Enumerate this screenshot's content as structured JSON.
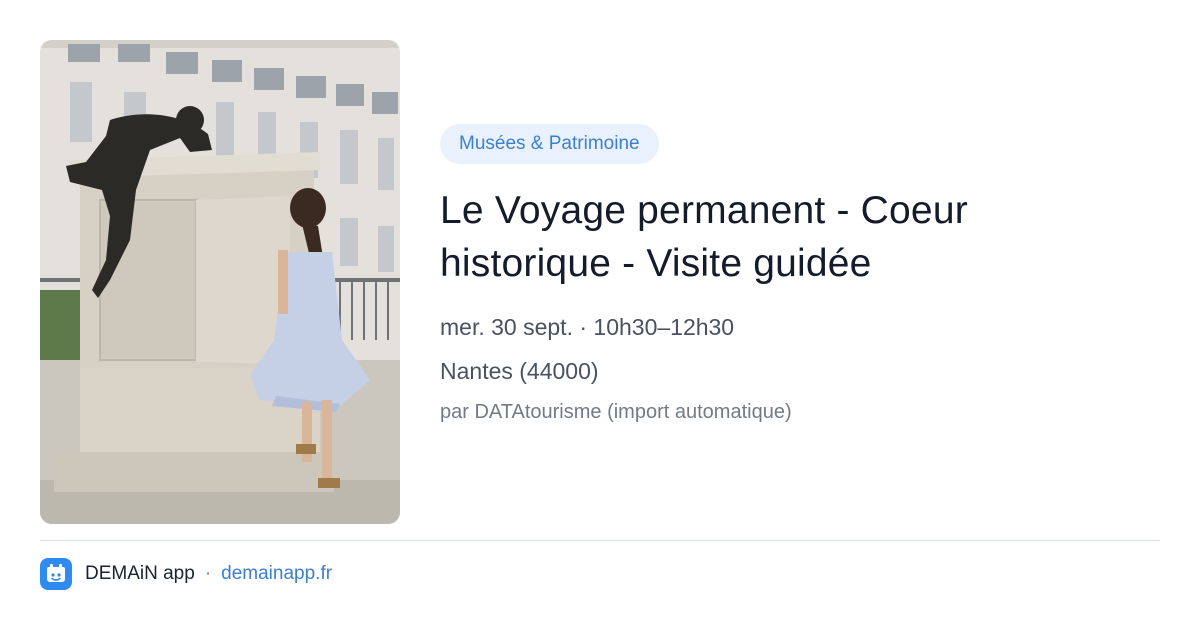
{
  "card": {
    "image_alt": "Statue en bronze sur un piédestal et une fillette en robe bleue",
    "category": "Musées & Patrimoine",
    "title_line1": "Le Voyage permanent - Coeur",
    "title_line2": "historique - Visite guidée",
    "datetime": "mer. 30 sept. · 10h30–12h30",
    "location": "Nantes (44000)",
    "source": "par DATAtourisme (import automatique)"
  },
  "footer": {
    "app_name": "DEMAiN app",
    "separator": "·",
    "domain": "demainapp.fr"
  },
  "icons": {
    "app_logo": "demain-app-logo-icon"
  },
  "colors": {
    "accent": "#3d7fcf",
    "chip_background": "#e9f2fc",
    "logo_background": "#2f8bf0"
  }
}
